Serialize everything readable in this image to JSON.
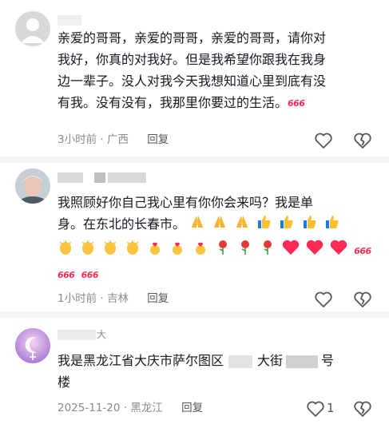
{
  "comments": [
    {
      "text_lines": [
        "亲爱的哥哥，亲爱的哥哥，亲爱的哥哥，请你对",
        "我好，你真的对我好。但是我希望你跟我在我身",
        "边一辈子。没人对我今天我想知道心里到底有没",
        "有我。没有没有，我那里你要过的生活。"
      ],
      "emoji_666": "666",
      "time": "3小时前",
      "location": "广西",
      "reply_label": "回复"
    },
    {
      "text_lines": [
        "我照顾好你自己我心里有你你会来吗？我是单",
        "身。在东北的长春市。"
      ],
      "emoji_666": "666",
      "time": "1小时前",
      "location": "吉林",
      "reply_label": "回复"
    },
    {
      "name_visible": "大",
      "text_part1": "我是黑龙江省大庆市萨尔图区",
      "text_part2": "大街",
      "text_part3": "号",
      "text_line2": "楼",
      "time": "2025-11-20",
      "location": "黑龙江",
      "reply_label": "回复",
      "like_count": "1"
    }
  ],
  "separator": "·",
  "icons": [
    "avatar-default-icon",
    "heart-outline-icon",
    "broken-heart-icon",
    "fire-666-icon",
    "pray-hands-icon",
    "thumbs-up-icon",
    "clap-icon",
    "rose-icon",
    "red-heart-icon",
    "moon-avatar-icon"
  ]
}
